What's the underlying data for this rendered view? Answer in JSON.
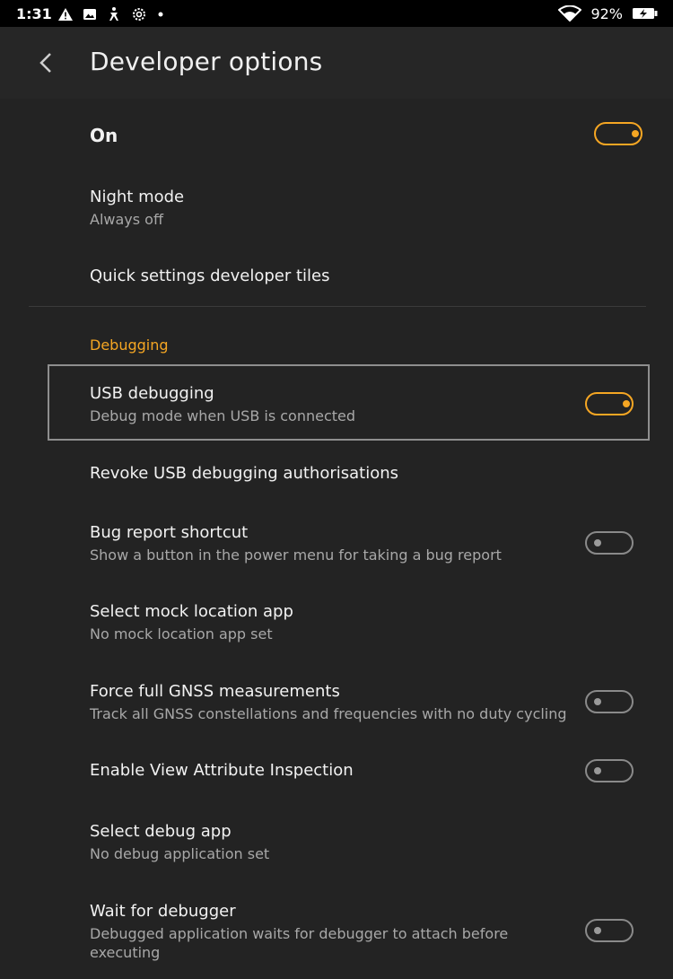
{
  "status_bar": {
    "time": "1:31",
    "icons": [
      "warning-icon",
      "image-icon",
      "accessibility-icon",
      "settings-icon",
      "dot-icon"
    ],
    "battery_percent": "92%"
  },
  "app_bar": {
    "title": "Developer options"
  },
  "master_toggle": {
    "label": "On",
    "state": true
  },
  "items": {
    "night_mode": {
      "title": "Night mode",
      "subtitle": "Always off"
    },
    "quick_tiles": {
      "title": "Quick settings developer tiles"
    },
    "section": "Debugging",
    "usb_debugging": {
      "title": "USB debugging",
      "subtitle": "Debug mode when USB is connected",
      "state": true
    },
    "revoke": {
      "title": "Revoke USB debugging authorisations"
    },
    "bug_report": {
      "title": "Bug report shortcut",
      "subtitle": "Show a button in the power menu for taking a bug report",
      "state": false
    },
    "mock_location": {
      "title": "Select mock location app",
      "subtitle": "No mock location app set"
    },
    "gnss": {
      "title": "Force full GNSS measurements",
      "subtitle": "Track all GNSS constellations and frequencies with no duty cycling",
      "state": false
    },
    "view_attr": {
      "title": "Enable View Attribute Inspection",
      "state": false
    },
    "debug_app": {
      "title": "Select debug app",
      "subtitle": "No debug application set"
    },
    "wait_debugger": {
      "title": "Wait for debugger",
      "subtitle_line1": "Debugged application waits for debugger to attach before",
      "subtitle_line2": "executing",
      "state": false
    }
  },
  "colors": {
    "accent": "#f5a623",
    "background": "#232323",
    "app_bar": "#262626",
    "status_bar": "#000000"
  }
}
